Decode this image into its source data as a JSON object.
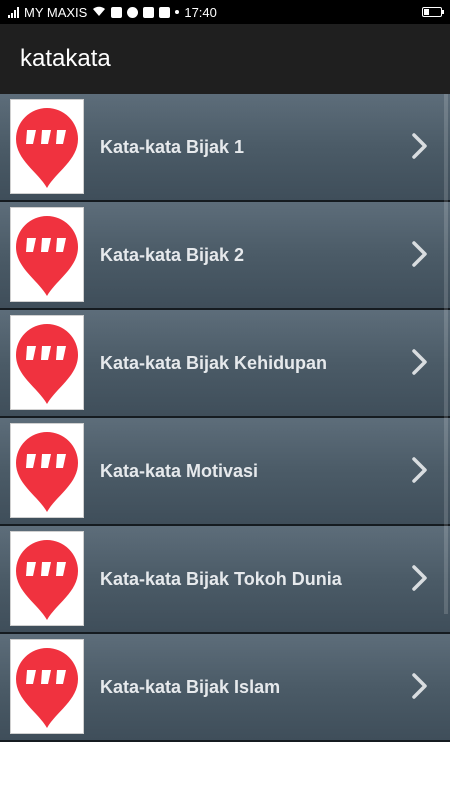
{
  "status_bar": {
    "carrier": "MY MAXIS",
    "time": "17:40",
    "icons": [
      "signal-icon",
      "wifi-icon",
      "mail-icon",
      "telegram-icon",
      "facebook-icon",
      "gmail-icon",
      "dot-icon",
      "battery-icon"
    ],
    "battery_level": 0.25
  },
  "app_bar": {
    "title": "katakata"
  },
  "colors": {
    "app_bar": "#1f1f1f",
    "row_top": "#5d6d7a",
    "row_bottom": "#3f4e5a",
    "icon_red": "#f0323f",
    "label_text": "#e6e9ec"
  },
  "list": {
    "items": [
      {
        "label": "Kata-kata Bijak 1",
        "icon": "quote-bubble-icon"
      },
      {
        "label": "Kata-kata Bijak 2",
        "icon": "quote-bubble-icon"
      },
      {
        "label": "Kata-kata Bijak Kehidupan",
        "icon": "quote-bubble-icon"
      },
      {
        "label": "Kata-kata Motivasi",
        "icon": "quote-bubble-icon"
      },
      {
        "label": "Kata-kata Bijak Tokoh Dunia",
        "icon": "quote-bubble-icon"
      },
      {
        "label": "Kata-kata Bijak Islam",
        "icon": "quote-bubble-icon"
      }
    ]
  }
}
